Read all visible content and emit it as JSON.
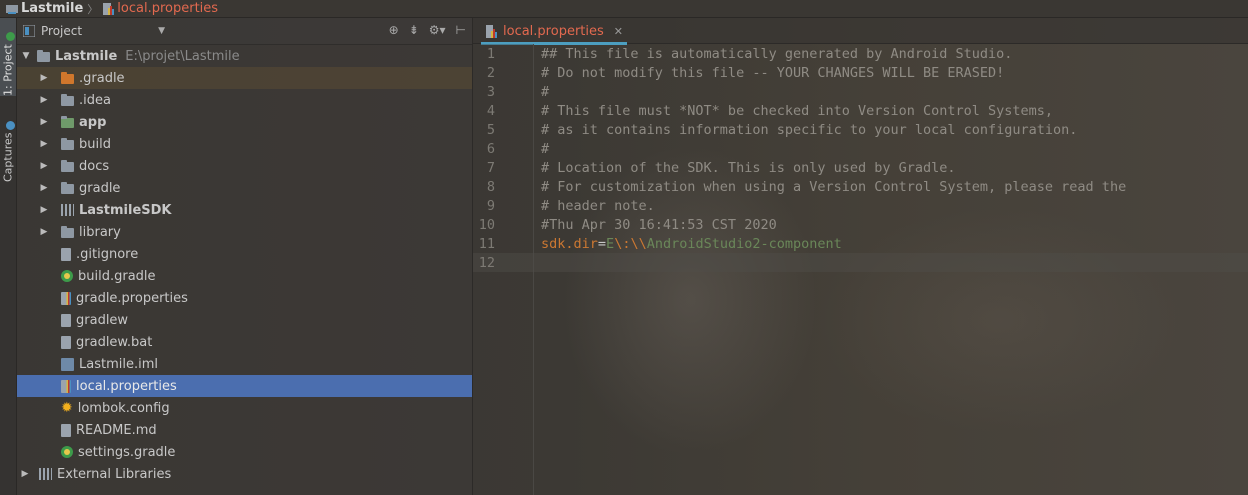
{
  "breadcrumb": {
    "project": "Lastmile",
    "file": "local.properties"
  },
  "strip": {
    "project_tab": "1: Project",
    "captures_tab": "Captures"
  },
  "project_panel": {
    "title": "Project",
    "root": {
      "name": "Lastmile",
      "path": "E:\\projet\\Lastmile"
    },
    "items": [
      {
        "label": ".gradle"
      },
      {
        "label": ".idea"
      },
      {
        "label": "app"
      },
      {
        "label": "build"
      },
      {
        "label": "docs"
      },
      {
        "label": "gradle"
      },
      {
        "label": "LastmileSDK"
      },
      {
        "label": "library"
      },
      {
        "label": ".gitignore"
      },
      {
        "label": "build.gradle"
      },
      {
        "label": "gradle.properties"
      },
      {
        "label": "gradlew"
      },
      {
        "label": "gradlew.bat"
      },
      {
        "label": "Lastmile.iml"
      },
      {
        "label": "local.properties"
      },
      {
        "label": "lombok.config"
      },
      {
        "label": "README.md"
      },
      {
        "label": "settings.gradle"
      }
    ],
    "external": "External Libraries"
  },
  "editor": {
    "tab_label": "local.properties",
    "lines": [
      {
        "n": "1",
        "text": "## This file is automatically generated by Android Studio."
      },
      {
        "n": "2",
        "text": "# Do not modify this file -- YOUR CHANGES WILL BE ERASED!"
      },
      {
        "n": "3",
        "text": "#"
      },
      {
        "n": "4",
        "text": "# This file must *NOT* be checked into Version Control Systems,"
      },
      {
        "n": "5",
        "text": "# as it contains information specific to your local configuration."
      },
      {
        "n": "6",
        "text": "#"
      },
      {
        "n": "7",
        "text": "# Location of the SDK. This is only used by Gradle."
      },
      {
        "n": "8",
        "text": "# For customization when using a Version Control System, please read the"
      },
      {
        "n": "9",
        "text": "# header note."
      },
      {
        "n": "10",
        "text": "#Thu Apr 30 16:41:53 CST 2020"
      },
      {
        "n": "11",
        "key": "sdk.dir",
        "eq": "=",
        "val1": "E",
        "esc": "\\:\\\\",
        "val2": "AndroidStudio2-component"
      },
      {
        "n": "12",
        "text": ""
      }
    ]
  },
  "colors": {
    "selection": "#4b6eaf",
    "tab_accent": "#4c9ec0",
    "open_file": "#e2694f",
    "comment": "#8f8b84",
    "key": "#cc7832",
    "value": "#6a8759"
  }
}
